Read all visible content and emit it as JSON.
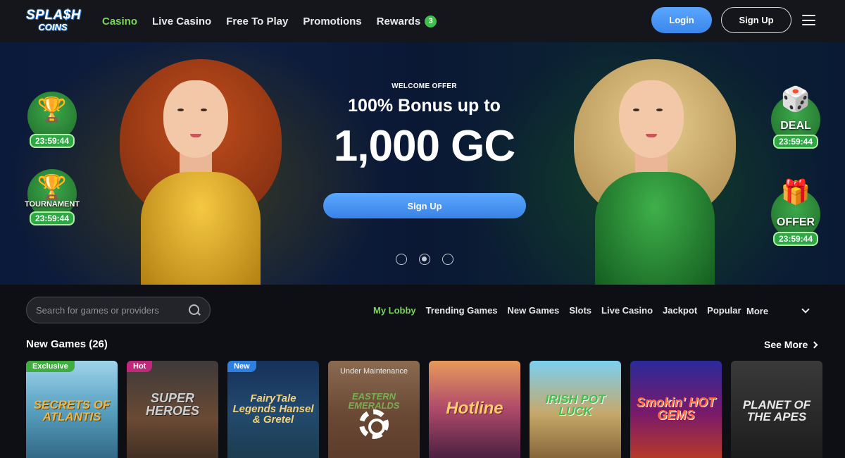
{
  "brand": {
    "line1": "SPLA$H",
    "line2": "COINS"
  },
  "nav": {
    "links": [
      {
        "label": "Casino",
        "active": true
      },
      {
        "label": "Live Casino",
        "active": false
      },
      {
        "label": "Free To Play",
        "active": false
      },
      {
        "label": "Promotions",
        "active": false
      },
      {
        "label": "Rewards",
        "active": false,
        "badge": "3"
      }
    ],
    "login_label": "Login",
    "signup_label": "Sign Up",
    "menu_icon": "hamburger-icon"
  },
  "hero": {
    "eyebrow": "WELCOME OFFER",
    "headline": "100% Bonus up to",
    "amount": "1,000 GC",
    "cta_label": "Sign Up",
    "slides": 3,
    "active_slide": 2,
    "promos_left": [
      {
        "icon": "trophy-shark-icon",
        "label": "",
        "timer": "23:59:44"
      },
      {
        "icon": "trophy-shark-icon",
        "label": "TOURNAMENT",
        "timer": "23:59:44"
      }
    ],
    "promos_right": [
      {
        "icon": "dice-icon",
        "label": "DEAL",
        "timer": "23:59:44"
      },
      {
        "icon": "gift-icon",
        "label": "OFFER",
        "timer": "23:59:44"
      }
    ]
  },
  "filters": {
    "search_placeholder": "Search for games or providers",
    "categories": [
      "My Lobby",
      "Trending Games",
      "New Games",
      "Slots",
      "Live Casino",
      "Jackpot",
      "Popular"
    ],
    "active_category": "My Lobby",
    "more_label": "More"
  },
  "section": {
    "title": "New Games (26)",
    "see_more": "See More"
  },
  "games": [
    {
      "title": "SECRETS OF ATLANTIS",
      "tag": "Exclusive",
      "tag_color": "#3fae3f"
    },
    {
      "title": "SUPER HEROES",
      "tag": "Hot",
      "tag_color": "#c0287a"
    },
    {
      "title": "FairyTale Legends Hansel & Gretel",
      "tag": "New",
      "tag_color": "#2f7fe0"
    },
    {
      "title": "EASTERN EMERALDS",
      "tag": "",
      "maintenance": "Under Maintenance"
    },
    {
      "title": "Hotline",
      "tag": ""
    },
    {
      "title": "IRISH POT LUCK",
      "tag": ""
    },
    {
      "title": "Smokin' HOT GEMS",
      "tag": ""
    },
    {
      "title": "PLANET OF THE APES",
      "tag": ""
    }
  ],
  "colors": {
    "accent_green": "#7ad65b",
    "button_blue": "#4a95f5",
    "background": "#0d0f14"
  }
}
